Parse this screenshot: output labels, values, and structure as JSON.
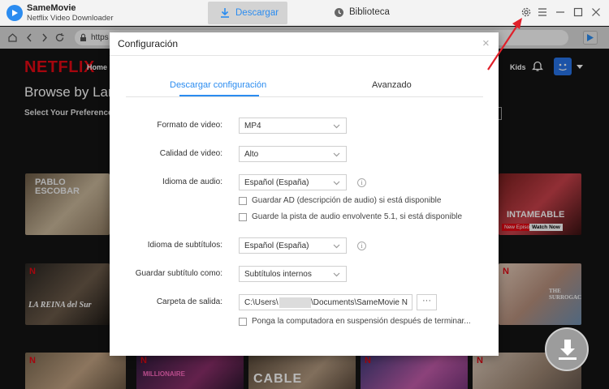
{
  "app": {
    "name": "SameMovie",
    "subtitle": "Netflix Video Downloader"
  },
  "tabs": {
    "download": "Descargar",
    "library": "Biblioteca"
  },
  "browser": {
    "url": "https"
  },
  "netflix": {
    "logo": "NETFLIX",
    "nav_home": "Home",
    "nav_kids": "Kids",
    "browse_heading": "Browse by Lan",
    "prefs_text": "Select Your Preferences",
    "thumbs": {
      "pablo": "PABLO ESCOBAR",
      "unstoppable": "INTAMEABLE",
      "new_episode": "New Episode",
      "watch_now": "Watch Now",
      "reina": "LA REINA del Sur",
      "surrogacy": "THE SURROGACY",
      "cable": "CABLE",
      "mm": "MILLIONAIRE"
    }
  },
  "dialog": {
    "title": "Configuración",
    "tab_download": "Descargar configuración",
    "tab_advanced": "Avanzado",
    "fields": {
      "video_format_label": "Formato de video:",
      "video_format_value": "MP4",
      "video_quality_label": "Calidad de video:",
      "video_quality_value": "Alto",
      "audio_lang_label": "Idioma de audio:",
      "audio_lang_value": "Español (España)",
      "ad_checkbox": "Guardar AD (descripción de audio) si está disponible",
      "surround_checkbox": "Guarde la pista de audio envolvente 5.1, si está disponible",
      "subtitle_lang_label": "Idioma de subtítulos:",
      "subtitle_lang_value": "Español (España)",
      "subtitle_save_label": "Guardar subtítulo como:",
      "subtitle_save_value": "Subtítulos internos",
      "output_label": "Carpeta de salida:",
      "output_prefix": "C:\\Users\\",
      "output_suffix": "\\Documents\\SameMovie N",
      "browse_label": "···",
      "sleep_checkbox": "Ponga la computadora en suspensión después de terminar..."
    }
  },
  "colors": {
    "accent": "#2b8cf0",
    "netflix_red": "#e50914",
    "annotation_arrow": "#e0202a"
  },
  "icons": {
    "download_tab": "download-icon",
    "library_tab": "clock-icon",
    "settings": "gear-icon",
    "menu": "hamburger-icon",
    "fab": "download-arrow-icon"
  }
}
